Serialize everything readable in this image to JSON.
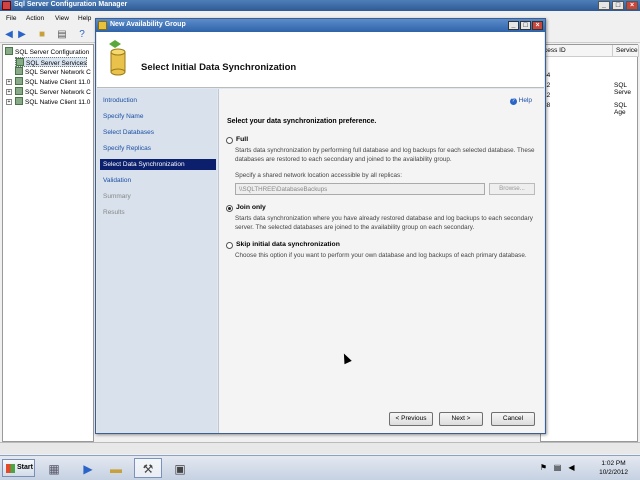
{
  "app": {
    "title": "Sql Server Configuration Manager",
    "menu": [
      "File",
      "Action",
      "View",
      "Help"
    ],
    "tree": [
      {
        "label": "SQL Server Configuration"
      },
      {
        "label": "SQL Server Services"
      },
      {
        "label": "SQL Server Network C"
      },
      {
        "label": "SQL Native Client 11.0"
      },
      {
        "label": "SQL Server Network C"
      },
      {
        "label": "SQL Native Client 11.0"
      }
    ],
    "list": {
      "headers": [
        "cess ID",
        "Service"
      ],
      "rows": [
        {
          "id": "64",
          "service": ""
        },
        {
          "id": "12",
          "service": "SQL Serve"
        },
        {
          "id": "12",
          "service": ""
        },
        {
          "id": "88",
          "service": "SQL Age"
        }
      ]
    }
  },
  "dialog": {
    "title": "New Availability Group",
    "page_title": "Select Initial Data Synchronization",
    "help": "Help",
    "steps": [
      {
        "label": "Introduction",
        "state": "done"
      },
      {
        "label": "Specify Name",
        "state": "done"
      },
      {
        "label": "Select Databases",
        "state": "done"
      },
      {
        "label": "Specify Replicas",
        "state": "done"
      },
      {
        "label": "Select Data Synchronization",
        "state": "active"
      },
      {
        "label": "Validation",
        "state": "done"
      },
      {
        "label": "Summary",
        "state": "disabled"
      },
      {
        "label": "Results",
        "state": "disabled"
      }
    ],
    "prompt": "Select your data synchronization preference.",
    "options": [
      {
        "label": "Full",
        "checked": false,
        "desc": "Starts data synchronization by performing full database and log backups for each selected database. These databases are restored to each secondary and joined to the availability group."
      },
      {
        "label": "Join only",
        "checked": true,
        "desc": "Starts data synchronization where you have already restored database and log backups to each secondary server. The selected databases are joined to the availability group on each secondary."
      },
      {
        "label": "Skip initial data synchronization",
        "checked": false,
        "desc": "Choose this option if you want to perform your own database and log backups of each primary database."
      }
    ],
    "share_label": "Specify a shared network location accessible by all replicas:",
    "share_value": "\\\\SQLTHREE\\DatabaseBackups",
    "browse": "Browse...",
    "buttons": {
      "previous": "< Previous",
      "next": "Next >",
      "cancel": "Cancel"
    }
  },
  "taskbar": {
    "start": "Start",
    "time": "1:02 PM",
    "date": "10/2/2012"
  }
}
